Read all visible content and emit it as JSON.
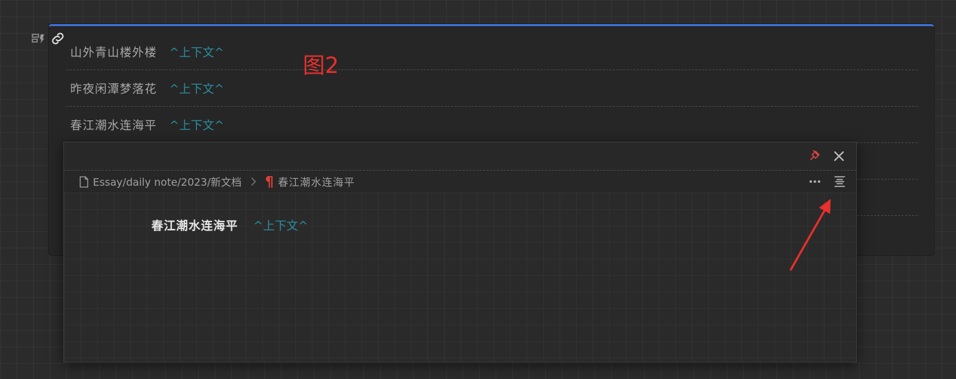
{
  "canvas": {
    "card": {
      "rows": [
        {
          "text": "山外青山楼外楼",
          "ref": "^上下文^"
        },
        {
          "text": "昨夜闲潭梦落花",
          "ref": "^上下文^"
        },
        {
          "text": "春江潮水连海平",
          "ref": "^上下文^"
        }
      ]
    },
    "annotation_label": "图2"
  },
  "popover": {
    "breadcrumb": {
      "path": "Essay/daily note/2023/新文档",
      "block": "春江潮水连海平"
    },
    "body": {
      "text": "春江潮水连海平",
      "ref": "^上下文^"
    }
  },
  "icons": {
    "pin": "pin-icon",
    "close": "close-icon",
    "more": "more-horizontal-icon",
    "align": "align-center-icon",
    "file": "file-icon",
    "paragraph": "paragraph-icon",
    "link": "link-icon"
  },
  "colors": {
    "accent_border": "#3f6fd6",
    "link_ref": "#2b8ea0",
    "annotation_red": "#e8302c"
  }
}
